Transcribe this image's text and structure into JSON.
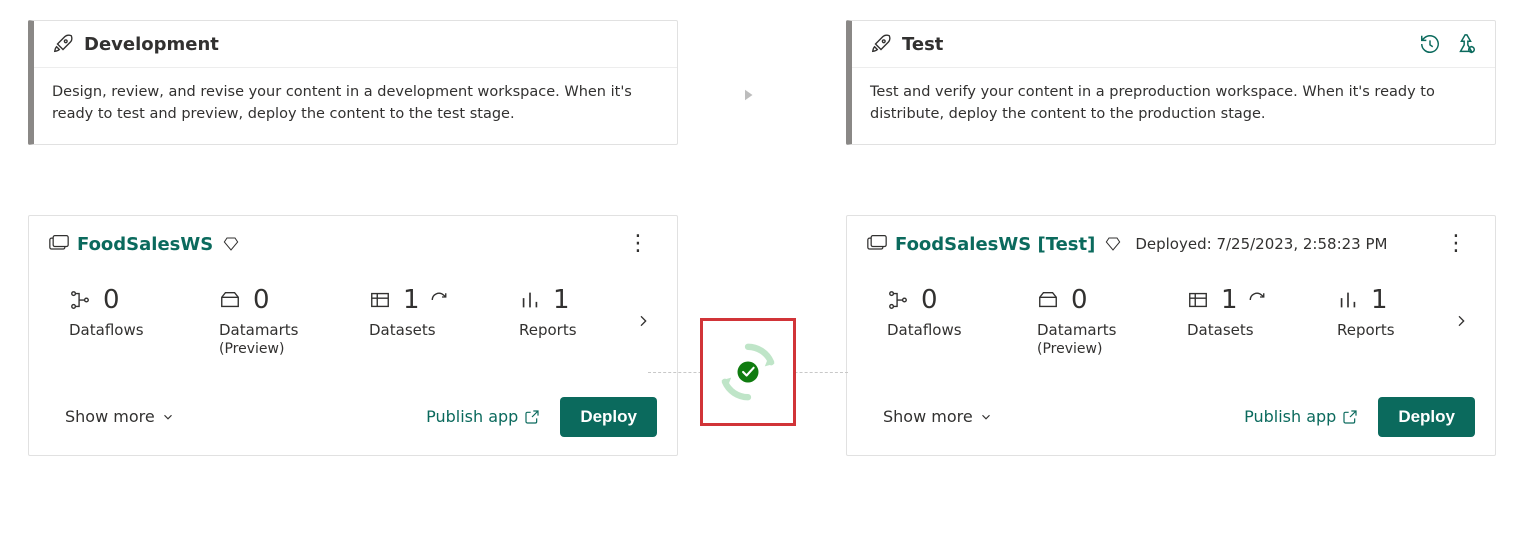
{
  "stages": {
    "development": {
      "title": "Development",
      "description": "Design, review, and revise your content in a development workspace. When it's ready to test and preview, deploy the content to the test stage."
    },
    "test": {
      "title": "Test",
      "description": "Test and verify your content in a preproduction workspace. When it's ready to distribute, deploy the content to the production stage."
    }
  },
  "workspaces": {
    "development": {
      "name": "FoodSalesWS",
      "metrics": {
        "dataflows": {
          "value": "0",
          "label": "Dataflows"
        },
        "datamarts": {
          "value": "0",
          "label": "Datamarts",
          "sub": "(Preview)"
        },
        "datasets": {
          "value": "1",
          "label": "Datasets"
        },
        "reports": {
          "value": "1",
          "label": "Reports"
        }
      }
    },
    "test": {
      "name": "FoodSalesWS [Test]",
      "deployed": "Deployed: 7/25/2023, 2:58:23 PM",
      "metrics": {
        "dataflows": {
          "value": "0",
          "label": "Dataflows"
        },
        "datamarts": {
          "value": "0",
          "label": "Datamarts",
          "sub": "(Preview)"
        },
        "datasets": {
          "value": "1",
          "label": "Datasets"
        },
        "reports": {
          "value": "1",
          "label": "Reports"
        }
      }
    }
  },
  "actions": {
    "show_more": "Show more",
    "publish_app": "Publish app",
    "deploy": "Deploy"
  },
  "colors": {
    "accent": "#0b6a5d",
    "highlight_border": "#d13438",
    "success": "#0b6a0b"
  }
}
